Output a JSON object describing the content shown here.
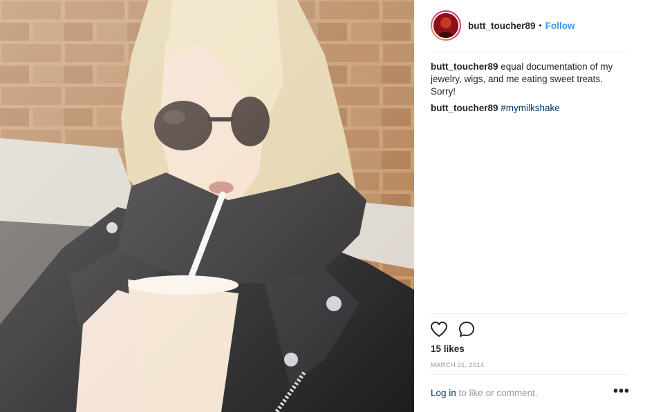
{
  "post": {
    "author": {
      "username": "butt_toucher89",
      "separator": "•",
      "follow_label": "Follow"
    },
    "caption": {
      "username": "butt_toucher89",
      "text": "equal documentation of my jewelry, wigs, and me eating sweet treats. Sorry!"
    },
    "comments": [
      {
        "username": "butt_toucher89",
        "text": "#mymilkshake"
      }
    ],
    "likes_label": "15 likes",
    "date": "MARCH 21, 2014"
  },
  "footer": {
    "login_label": "Log in",
    "rest_text": " to like or comment.",
    "more_label": "•••"
  },
  "icons": {
    "like": "heart-outline-icon",
    "comment": "comment-bubble-icon",
    "more": "more-options-icon"
  },
  "colors": {
    "accent": "#3897f0",
    "link": "#003569",
    "muted": "#999999",
    "text": "#262626"
  }
}
